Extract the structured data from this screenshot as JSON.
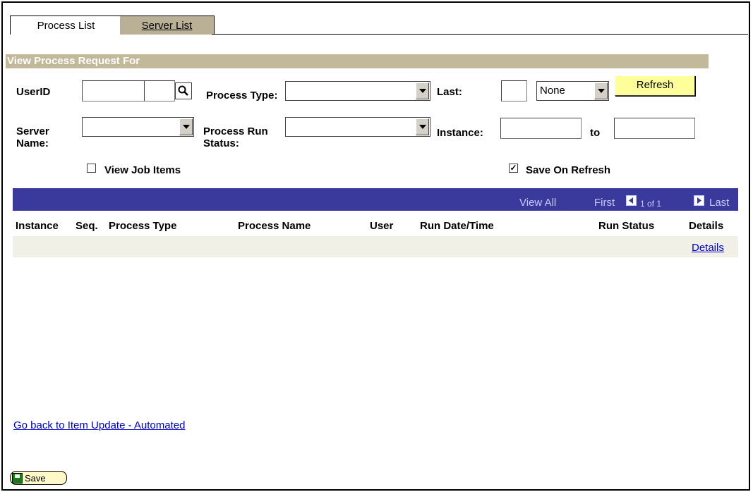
{
  "tabs": {
    "active": "Process List",
    "inactive": "Server List"
  },
  "section": {
    "title": "View Process Request For"
  },
  "filters": {
    "userid_label": "UserID",
    "userid_value": "",
    "process_type_label": "Process Type:",
    "process_type_value": "",
    "last_label": "Last:",
    "last_value": "",
    "last_unit_value": "None",
    "refresh_label": "Refresh",
    "server_name_label": "Server Name:",
    "server_name_value": "",
    "run_status_label": "Process Run Status:",
    "run_status_value": "",
    "instance_label": "Instance:",
    "instance_from": "",
    "to_label": "to",
    "instance_to": "",
    "view_job_items_label": "View Job Items",
    "view_job_items_checked": false,
    "save_on_refresh_label": "Save On Refresh",
    "save_on_refresh_checked": true
  },
  "grid": {
    "view_all": "View All",
    "first": "First",
    "page_info": "1 of 1",
    "last": "Last",
    "columns": [
      "Instance",
      "Seq.",
      "Process Type",
      "Process Name",
      "User",
      "Run Date/Time",
      "Run Status",
      "Details"
    ],
    "rows": [
      {
        "details_link": "Details"
      }
    ]
  },
  "footer": {
    "back_link": "Go back to Item Update - Automated",
    "save_label": "Save"
  },
  "colors": {
    "section_bar": "#c2b99b",
    "grid_bar": "#3a3a9c",
    "refresh_button": "#ffff99",
    "link": "#0000cc"
  }
}
